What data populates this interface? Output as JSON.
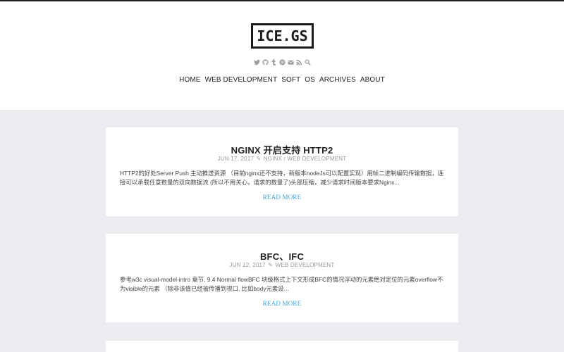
{
  "site": {
    "logo": "ICE.GS",
    "social_icons": [
      "twitter-icon",
      "github-icon",
      "tumblr-icon",
      "pinterest-icon",
      "mail-icon",
      "rss-icon",
      "search-icon"
    ],
    "nav": [
      "HOME",
      "WEB DEVELOPMENT",
      "SOFT",
      "OS",
      "ARCHIVES",
      "ABOUT"
    ]
  },
  "posts": [
    {
      "title": "NGINX 开启支持 HTTP2",
      "date": "JUN 17, 2017",
      "categories": "NGINX / WEB DEVELOPMENT",
      "excerpt": "HTTP2的好处Server Push 主动推送资源 （目前nginx还不支持，新版本nodeJs可以配置实现）用帧二进制编码传输数据，连接可以承载任意数量的双向数据流 (所以不用关心，请求的数量了)头部压缩，减少请求时间版本要求Nginx...",
      "read_more": "READ MORE"
    },
    {
      "title": "BFC、IFC",
      "date": "JUN 12, 2017",
      "categories": "WEB DEVELOPMENT",
      "excerpt": "参考w3c visual-model-intro 章节, 9.4 Normal flowBFC 块级格式上下文形成BFC的情况浮动的元素绝对定位的元素overflow不为visible的元素 （除非该值已经被传播到视口, 比如body元素设...",
      "read_more": "READ MORE"
    }
  ],
  "colors": {
    "background": "#ebecef",
    "accent": "#3aa3d9",
    "text": "#222222"
  }
}
